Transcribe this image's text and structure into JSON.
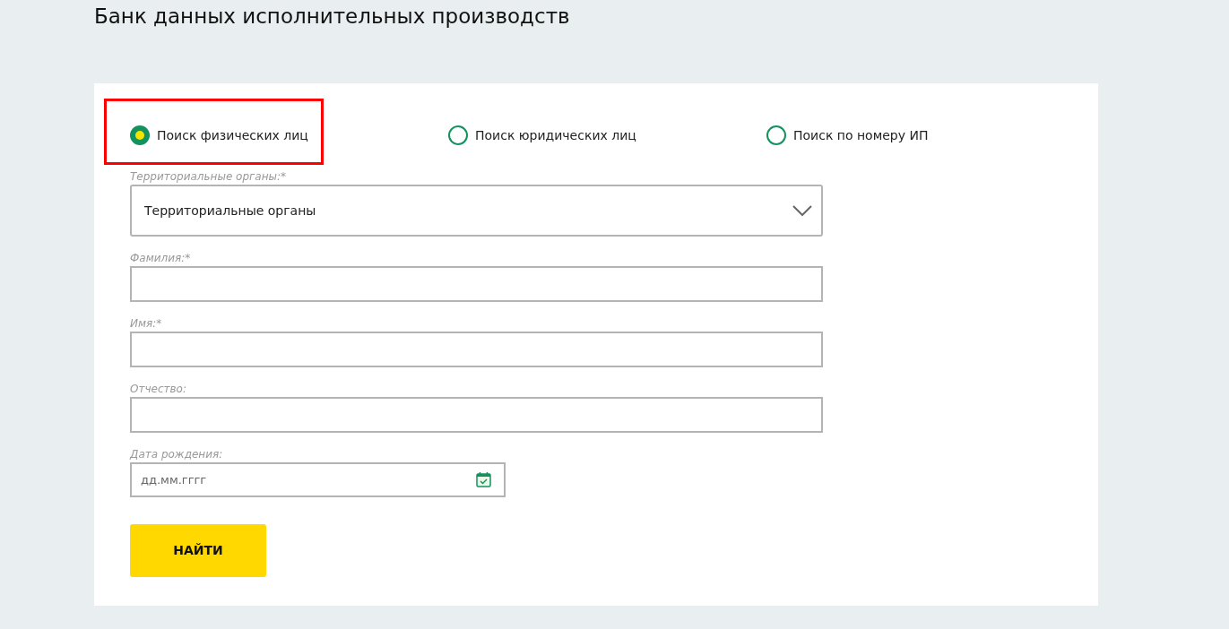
{
  "title": "Банк данных исполнительных производств",
  "search_modes": [
    {
      "label": "Поиск физических лиц",
      "selected": true,
      "highlighted": true
    },
    {
      "label": "Поиск юридических лиц",
      "selected": false,
      "highlighted": false
    },
    {
      "label": "Поиск по номеру ИП",
      "selected": false,
      "highlighted": false
    }
  ],
  "fields": [
    {
      "kind": "select",
      "label": "Территориальные органы:*",
      "value": "Территориальные органы"
    },
    {
      "kind": "text",
      "label": "Фамилия:*"
    },
    {
      "kind": "text",
      "label": "Имя:*"
    },
    {
      "kind": "text",
      "label": "Отчество:"
    },
    {
      "kind": "date",
      "label": "Дата рождения:",
      "placeholder": "дд.мм.гггг"
    }
  ],
  "submit_button": "НАЙТИ"
}
